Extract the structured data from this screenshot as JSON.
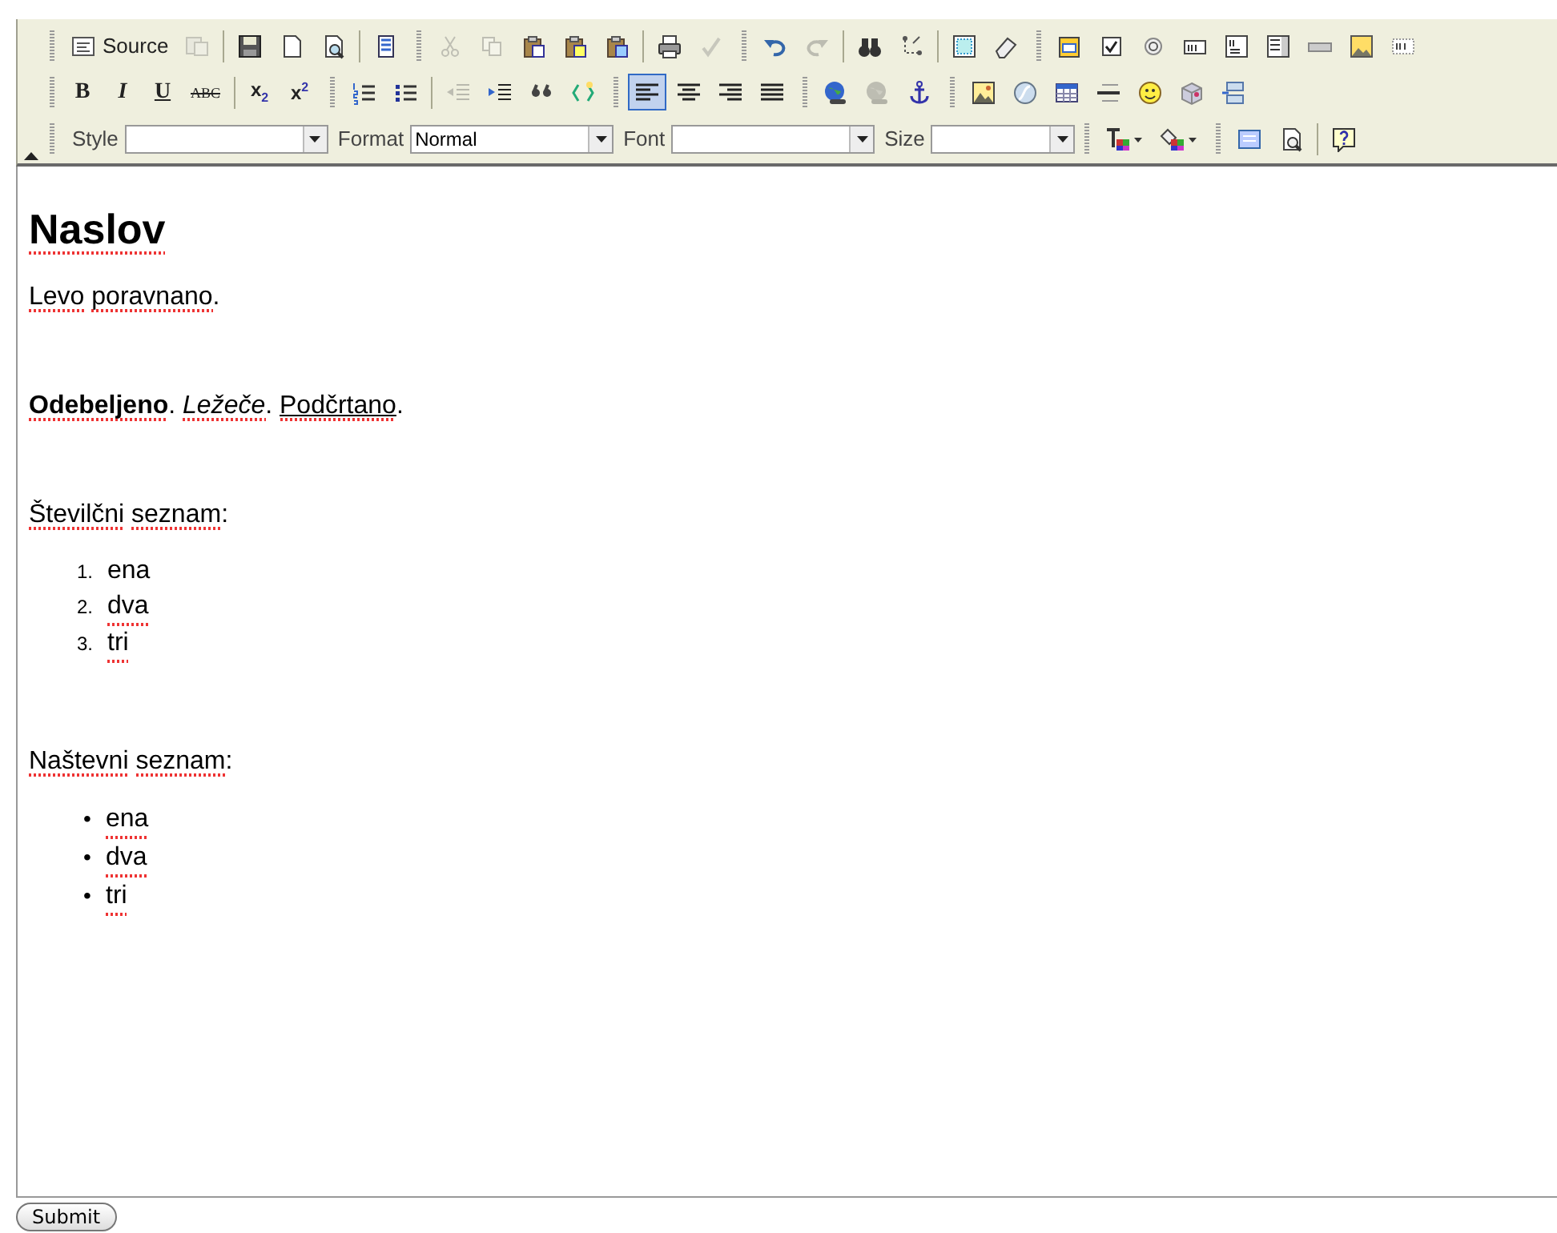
{
  "toolbar": {
    "rows": [
      [
        [
          {
            "kind": "icon-button",
            "label": "Source",
            "disabled": false
          },
          {
            "kind": "icon-button",
            "disabled": true
          },
          {
            "kind": "separator"
          },
          {
            "kind": "icon-button",
            "disabled": false
          },
          {
            "kind": "icon-button",
            "disabled": false
          },
          {
            "kind": "icon-button",
            "disabled": false
          },
          {
            "kind": "separator"
          },
          {
            "kind": "icon-button",
            "disabled": false
          }
        ],
        [
          {
            "kind": "icon-button",
            "disabled": true
          },
          {
            "kind": "icon-button",
            "disabled": true
          },
          {
            "kind": "icon-button",
            "disabled": false
          },
          {
            "kind": "icon-button",
            "disabled": false
          },
          {
            "kind": "icon-button",
            "disabled": false
          },
          {
            "kind": "separator"
          },
          {
            "kind": "icon-button",
            "disabled": false
          },
          {
            "kind": "icon-button",
            "disabled": true
          }
        ],
        [
          {
            "kind": "icon-button",
            "disabled": false
          },
          {
            "kind": "icon-button",
            "disabled": true
          },
          {
            "kind": "separator"
          },
          {
            "kind": "icon-button",
            "disabled": false
          },
          {
            "kind": "icon-button",
            "disabled": false
          },
          {
            "kind": "separator"
          },
          {
            "kind": "icon-button",
            "disabled": false
          },
          {
            "kind": "icon-button",
            "disabled": false
          }
        ],
        [
          {
            "kind": "icon-button"
          },
          {
            "kind": "icon-button"
          },
          {
            "kind": "icon-button"
          },
          {
            "kind": "icon-button"
          },
          {
            "kind": "icon-button"
          },
          {
            "kind": "icon-button"
          },
          {
            "kind": "icon-button"
          },
          {
            "kind": "icon-button"
          },
          {
            "kind": "icon-button"
          }
        ]
      ],
      [
        [
          {
            "kind": "text-button",
            "label": "B"
          },
          {
            "kind": "text-button",
            "label": "I"
          },
          {
            "kind": "text-button",
            "label": "U"
          },
          {
            "kind": "text-button",
            "label": "ABC"
          },
          {
            "kind": "separator"
          },
          {
            "kind": "text-button",
            "label": "x$_{2}$"
          },
          {
            "kind": "text-button",
            "label": "x$^{2}$"
          }
        ],
        [
          {
            "kind": "icon-button",
            "disabled": false
          },
          {
            "kind": "icon-button",
            "disabled": false
          },
          {
            "kind": "separator"
          },
          {
            "kind": "icon-button",
            "disabled": true
          },
          {
            "kind": "icon-button",
            "disabled": false
          },
          {
            "kind": "icon-button",
            "disabled": false
          },
          {
            "kind": "icon-button",
            "disabled": false
          }
        ],
        [
          {
            "kind": "icon-button",
            "selected": true
          },
          {
            "kind": "icon-button",
            "selected": false
          },
          {
            "kind": "icon-button",
            "selected": false
          },
          {
            "kind": "icon-button",
            "selected": false
          }
        ],
        [
          {
            "kind": "icon-button",
            "disabled": false
          },
          {
            "kind": "icon-button",
            "disabled": true
          },
          {
            "kind": "icon-button",
            "disabled": false
          }
        ],
        [
          {
            "kind": "icon-button"
          },
          {
            "kind": "icon-button"
          },
          {
            "kind": "icon-button"
          },
          {
            "kind": "icon-button"
          },
          {
            "kind": "icon-button"
          },
          {
            "kind": "icon-button"
          },
          {
            "kind": "icon-button"
          }
        ]
      ],
      [
        [
          {
            "kind": "combo",
            "label": "Style"
          },
          {
            "kind": "combo",
            "label": "Format",
            "value": "Normal"
          },
          {
            "kind": "combo",
            "label": "Font"
          },
          {
            "kind": "combo",
            "label": "Size"
          }
        ],
        [
          {
            "kind": "icon-button"
          },
          {
            "kind": "icon-button"
          }
        ],
        [
          {
            "kind": "icon-button"
          },
          {
            "kind": "icon-button"
          },
          {
            "kind": "separator"
          },
          {
            "kind": "icon-button"
          }
        ]
      ]
    ]
  },
  "document": {
    "blocks": [
      {
        "kind": "heading",
        "runs": [
          {
            "kind": "plain",
            "text": "Naslov",
            "misspelled": true
          }
        ]
      },
      {
        "kind": "paragraph",
        "runs": [
          {
            "kind": "plain",
            "text": "Levo ",
            "misspelled": true
          },
          {
            "kind": "plain",
            "text": "poravnano",
            "suffix": ".",
            "misspelled": true
          }
        ]
      },
      {
        "kind": "blank"
      },
      {
        "kind": "paragraph",
        "runs": [
          {
            "kind": "bold",
            "text": "Odebeljeno",
            "suffix": ". ",
            "misspelled": true
          },
          {
            "kind": "italic",
            "text": "Ležeče",
            "suffix": ". ",
            "misspelled": true
          },
          {
            "kind": "underline",
            "text": "Podčrtano",
            "suffix": ".",
            "misspelled": true
          }
        ]
      },
      {
        "kind": "blank"
      },
      {
        "kind": "paragraph",
        "runs": [
          {
            "kind": "plain",
            "text": "Številčni ",
            "misspelled": true
          },
          {
            "kind": "plain",
            "text": "seznam",
            "suffix": ":",
            "misspelled": true
          }
        ]
      },
      {
        "kind": "ordered-list",
        "items": [
          {
            "marker": "1.",
            "text": "ena",
            "misspelled": false
          },
          {
            "marker": "2.",
            "text": "dva",
            "misspelled": true
          },
          {
            "marker": "3.",
            "text": "tri",
            "misspelled": true
          }
        ]
      },
      {
        "kind": "blank"
      },
      {
        "kind": "paragraph",
        "runs": [
          {
            "kind": "plain",
            "text": "Naštevni ",
            "misspelled": true
          },
          {
            "kind": "plain",
            "text": "seznam",
            "suffix": ":",
            "misspelled": true
          }
        ]
      },
      {
        "kind": "bullet-list",
        "items": [
          {
            "marker": "•",
            "text": "ena",
            "misspelled": true
          },
          {
            "marker": "•",
            "text": "dva",
            "misspelled": true
          },
          {
            "marker": "•",
            "text": "tri",
            "misspelled": true
          }
        ]
      }
    ]
  },
  "submit": {
    "label": "Submit"
  }
}
